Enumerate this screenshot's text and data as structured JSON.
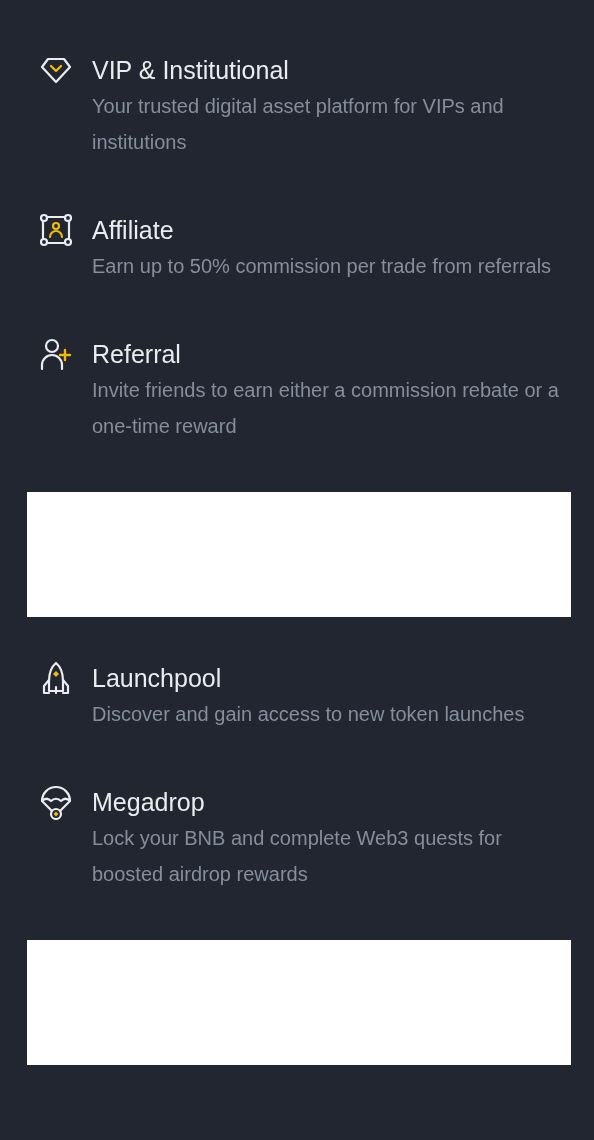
{
  "items": [
    {
      "kind": "entry",
      "title": "VIP & Institutional",
      "description": "Your trusted digital asset platform for VIPs and institutions"
    },
    {
      "kind": "entry",
      "title": "Affiliate",
      "description": "Earn up to 50% commission per trade from referrals"
    },
    {
      "kind": "entry",
      "title": "Referral",
      "description": "Invite friends to earn either a commission rebate or a one-time reward"
    },
    {
      "kind": "blank"
    },
    {
      "kind": "entry",
      "title": "Launchpool",
      "description": "Discover and gain access to new token launches"
    },
    {
      "kind": "entry",
      "title": "Megadrop",
      "description": "Lock your BNB and complete Web3 quests for boosted airdrop rewards"
    },
    {
      "kind": "blank"
    }
  ]
}
